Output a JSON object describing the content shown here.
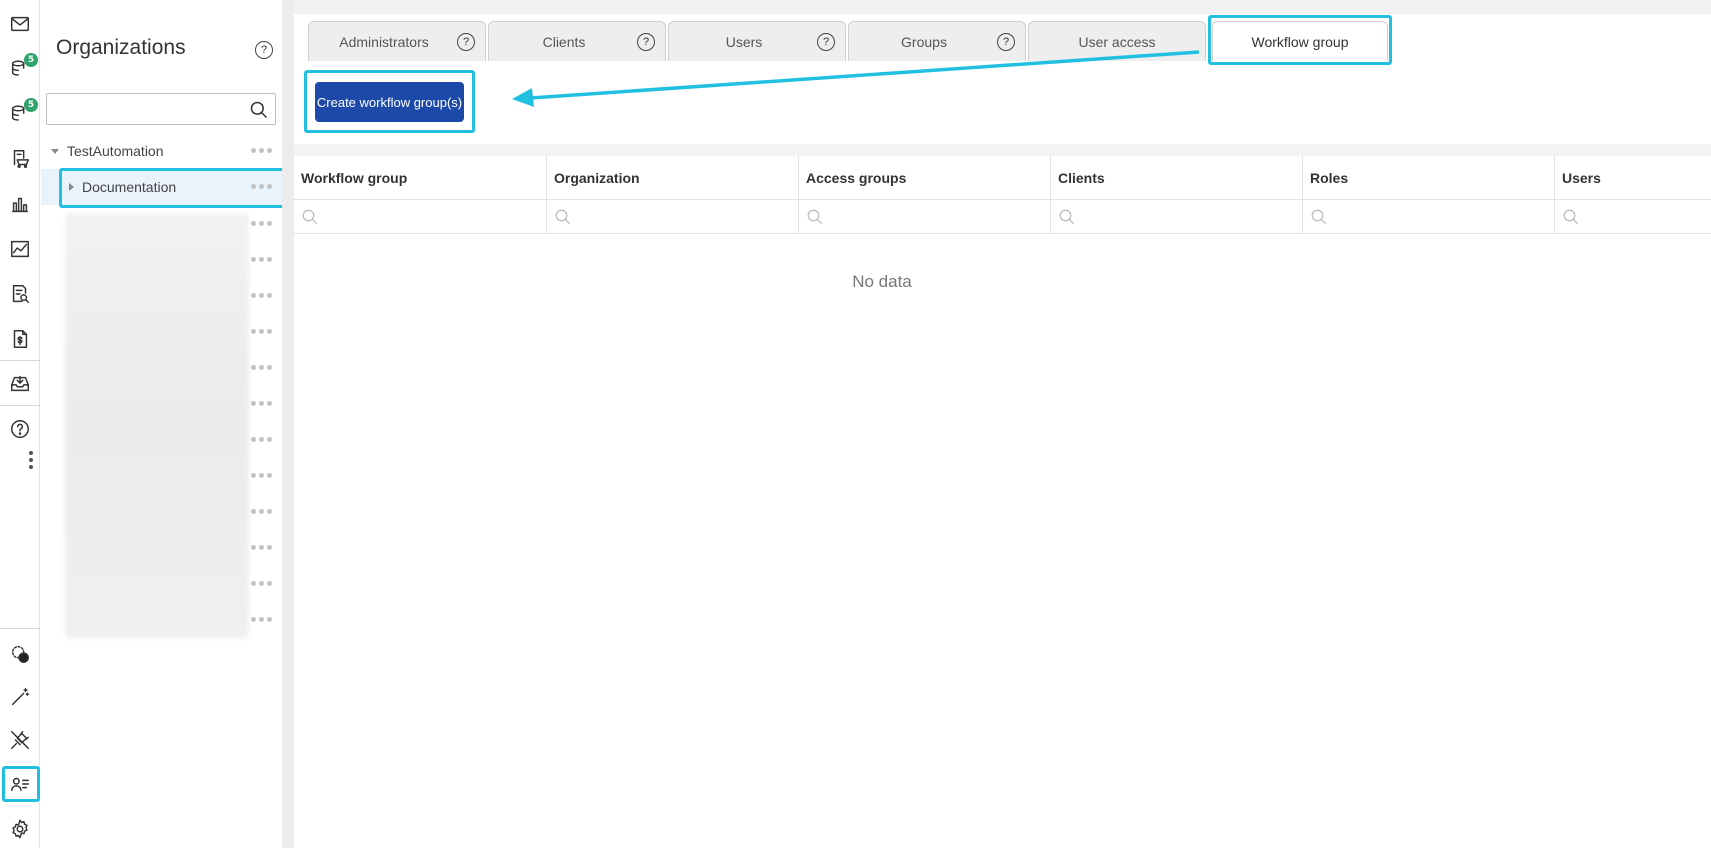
{
  "rail": {
    "mail_badge": "",
    "badge_one": "5",
    "badge_two": "5"
  },
  "org_panel": {
    "title": "Organizations",
    "help_glyph": "?",
    "search_placeholder": "",
    "tree": [
      {
        "label": "TestAutomation"
      },
      {
        "label": "Documentation"
      }
    ]
  },
  "tabs": [
    {
      "label": "Administrators",
      "help": "?"
    },
    {
      "label": "Clients",
      "help": "?"
    },
    {
      "label": "Users",
      "help": "?"
    },
    {
      "label": "Groups",
      "help": "?"
    },
    {
      "label": "User access"
    },
    {
      "label": "Workflow group"
    }
  ],
  "toolbar": {
    "create_label": "Create workflow group(s)"
  },
  "grid": {
    "columns": [
      "Workflow group",
      "Organization",
      "Access groups",
      "Clients",
      "Roles",
      "Users"
    ],
    "empty_text": "No data"
  },
  "colors": {
    "accent": "#22c0e0",
    "primary_button": "#1d4aa8",
    "badge": "#2ea36b"
  }
}
